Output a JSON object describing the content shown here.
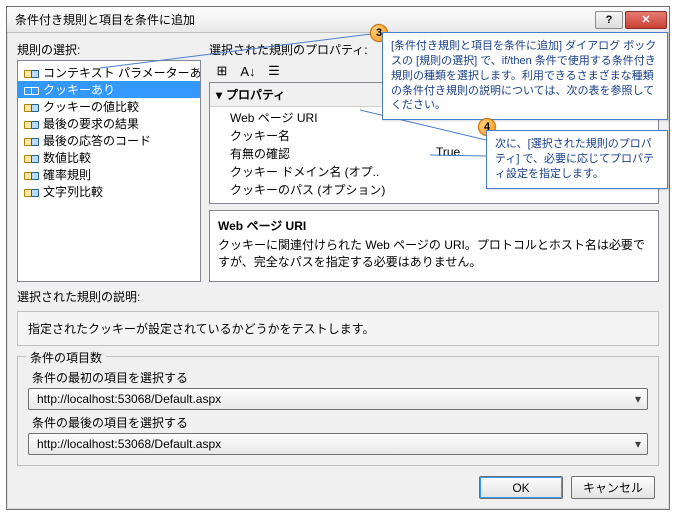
{
  "title": "条件付き規則と項目を条件に追加",
  "left": {
    "label": "規則の選択:",
    "items": [
      "コンテキスト パラメーターあり",
      "クッキーあり",
      "クッキーの値比較",
      "最後の要求の結果",
      "最後の応答のコード",
      "数値比較",
      "確率規則",
      "文字列比較"
    ],
    "selected_index": 1
  },
  "right": {
    "label": "選択された規則のプロパティ:",
    "toolbar": {
      "cat_icon": "⊞",
      "az_icon": "A↓",
      "prop_icon": "☰"
    },
    "category": "プロパティ",
    "rows": [
      {
        "name": "Web ページ URI",
        "value": ""
      },
      {
        "name": "クッキー名",
        "value": ""
      },
      {
        "name": "有無の確認",
        "value": "True"
      },
      {
        "name": "クッキー ドメイン名 (オプ..",
        "value": ""
      },
      {
        "name": "クッキーのパス (オプション)",
        "value": ""
      }
    ],
    "desc_title": "Web ページ URI",
    "desc_body": "クッキーに関連付けられた Web ページの URI。プロトコルとホスト名は必要ですが、完全なパスを指定する必要はありません。"
  },
  "selected_desc": {
    "label": "選択された規則の説明:",
    "text": "指定されたクッキーが設定されているかどうかをテストします。"
  },
  "items_group": {
    "legend": "条件の項目数",
    "first_label": "条件の最初の項目を選択する",
    "first_value": "http://localhost:53068/Default.aspx",
    "last_label": "条件の最後の項目を選択する",
    "last_value": "http://localhost:53068/Default.aspx"
  },
  "buttons": {
    "ok": "OK",
    "cancel": "キャンセル"
  },
  "callouts": {
    "c3_num": "3",
    "c3": "[条件付き規則と項目を条件に追加] ダイアログ ボックスの [規則の選択] で、if/then 条件で使用する条件付き規則の種類を選択します。利用できるさまざまな種類の条件付き規則の説明については、次の表を参照してください。",
    "c4_num": "4",
    "c4": "次に、[選択された規則のプロパティ] で、必要に応じてプロパティ設定を指定します。"
  }
}
